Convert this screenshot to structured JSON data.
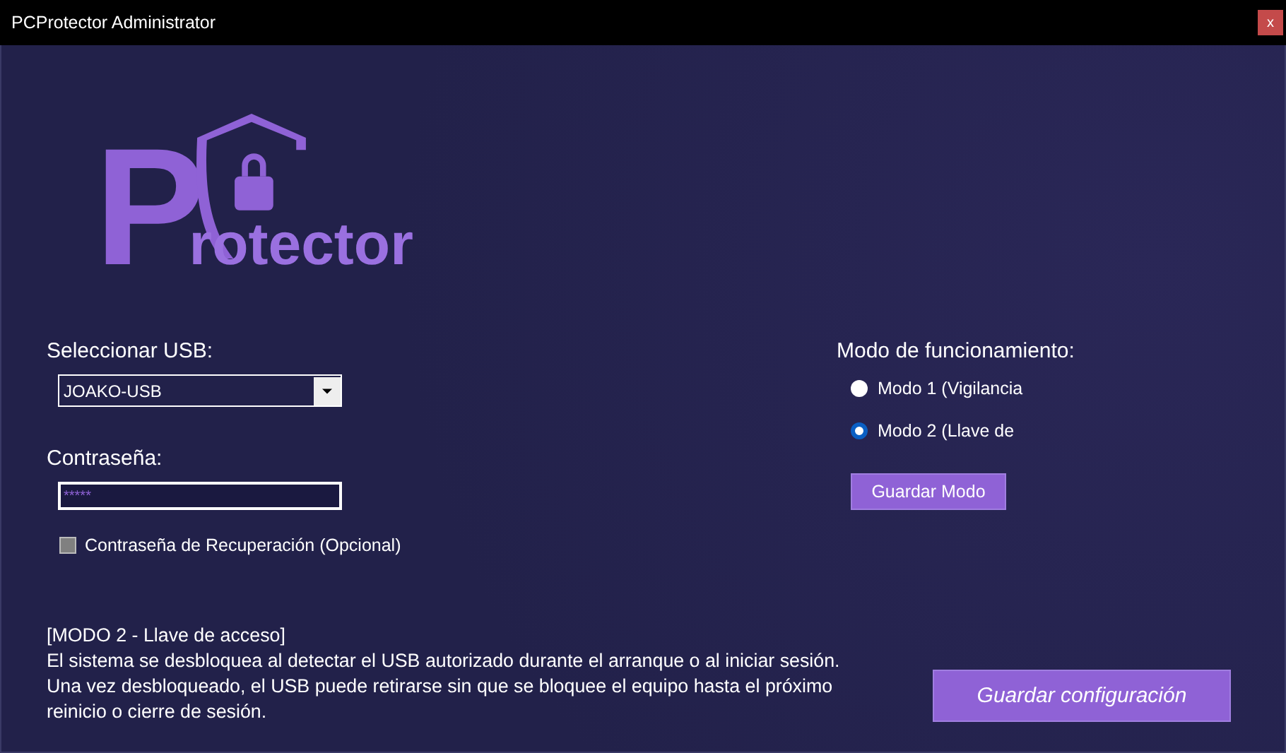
{
  "window": {
    "title": "PCProtector Administrator",
    "close": "x"
  },
  "logo": {
    "initial": "P",
    "rest": "rotector"
  },
  "usb": {
    "label": "Seleccionar USB:",
    "value": "JOAKO-USB"
  },
  "password": {
    "label": "Contraseña:",
    "value": "*****"
  },
  "recovery": {
    "label": "Contraseña de Recuperación (Opcional)",
    "checked": false
  },
  "mode": {
    "label": "Modo de funcionamiento:",
    "options": [
      {
        "label": "Modo 1 (Vigilancia",
        "selected": false
      },
      {
        "label": "Modo 2 (Llave de",
        "selected": true
      }
    ],
    "save_button": "Guardar Modo"
  },
  "description": [
    "[MODO 2 - Llave de acceso]",
    "El sistema se desbloquea al detectar el USB autorizado durante el arranque o al iniciar sesión.",
    "Una vez desbloqueado, el USB puede retirarse sin que se bloquee el equipo hasta el próximo",
    "reinicio o cierre de sesión."
  ],
  "save_config_button": "Guardar configuración"
}
